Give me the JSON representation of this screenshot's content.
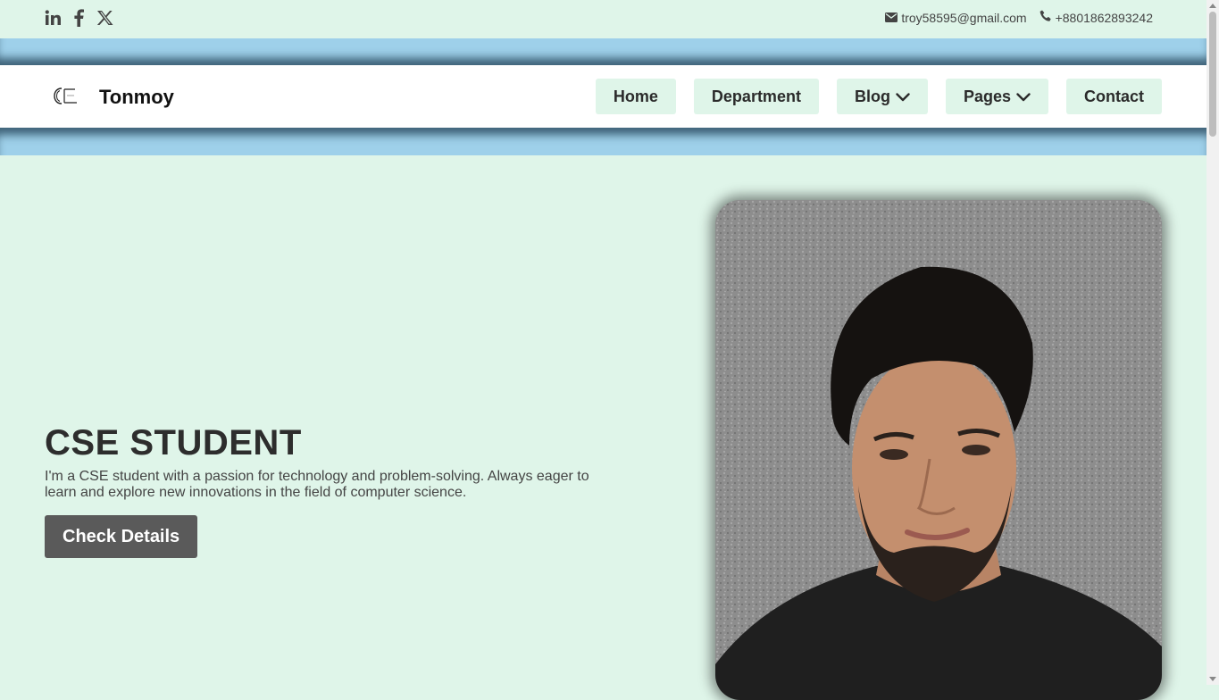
{
  "topbar": {
    "social": [
      {
        "icon": "linkedin-icon"
      },
      {
        "icon": "facebook-icon"
      },
      {
        "icon": "x-twitter-icon"
      }
    ],
    "email": "troy58595@gmail.com",
    "phone": "+8801862893242"
  },
  "navbar": {
    "brand": "Tonmoy",
    "items": [
      {
        "label": "Home"
      },
      {
        "label": "Department"
      },
      {
        "label": "Blog",
        "icon": "chevron-down-icon"
      },
      {
        "label": "Pages",
        "icon": "chevron-down-icon"
      },
      {
        "label": "Contact"
      }
    ]
  },
  "hero": {
    "title": "CSE STUDENT",
    "description": "I'm a CSE student with a passion for technology and problem-solving. Always eager to learn and explore new innovations in the field of computer science.",
    "button_label": "Check Details"
  },
  "colors": {
    "background": "#dff5e9",
    "band": "#9ed0ea",
    "nav_button": "#dff5e9",
    "cta_button": "#5a5a5a"
  }
}
